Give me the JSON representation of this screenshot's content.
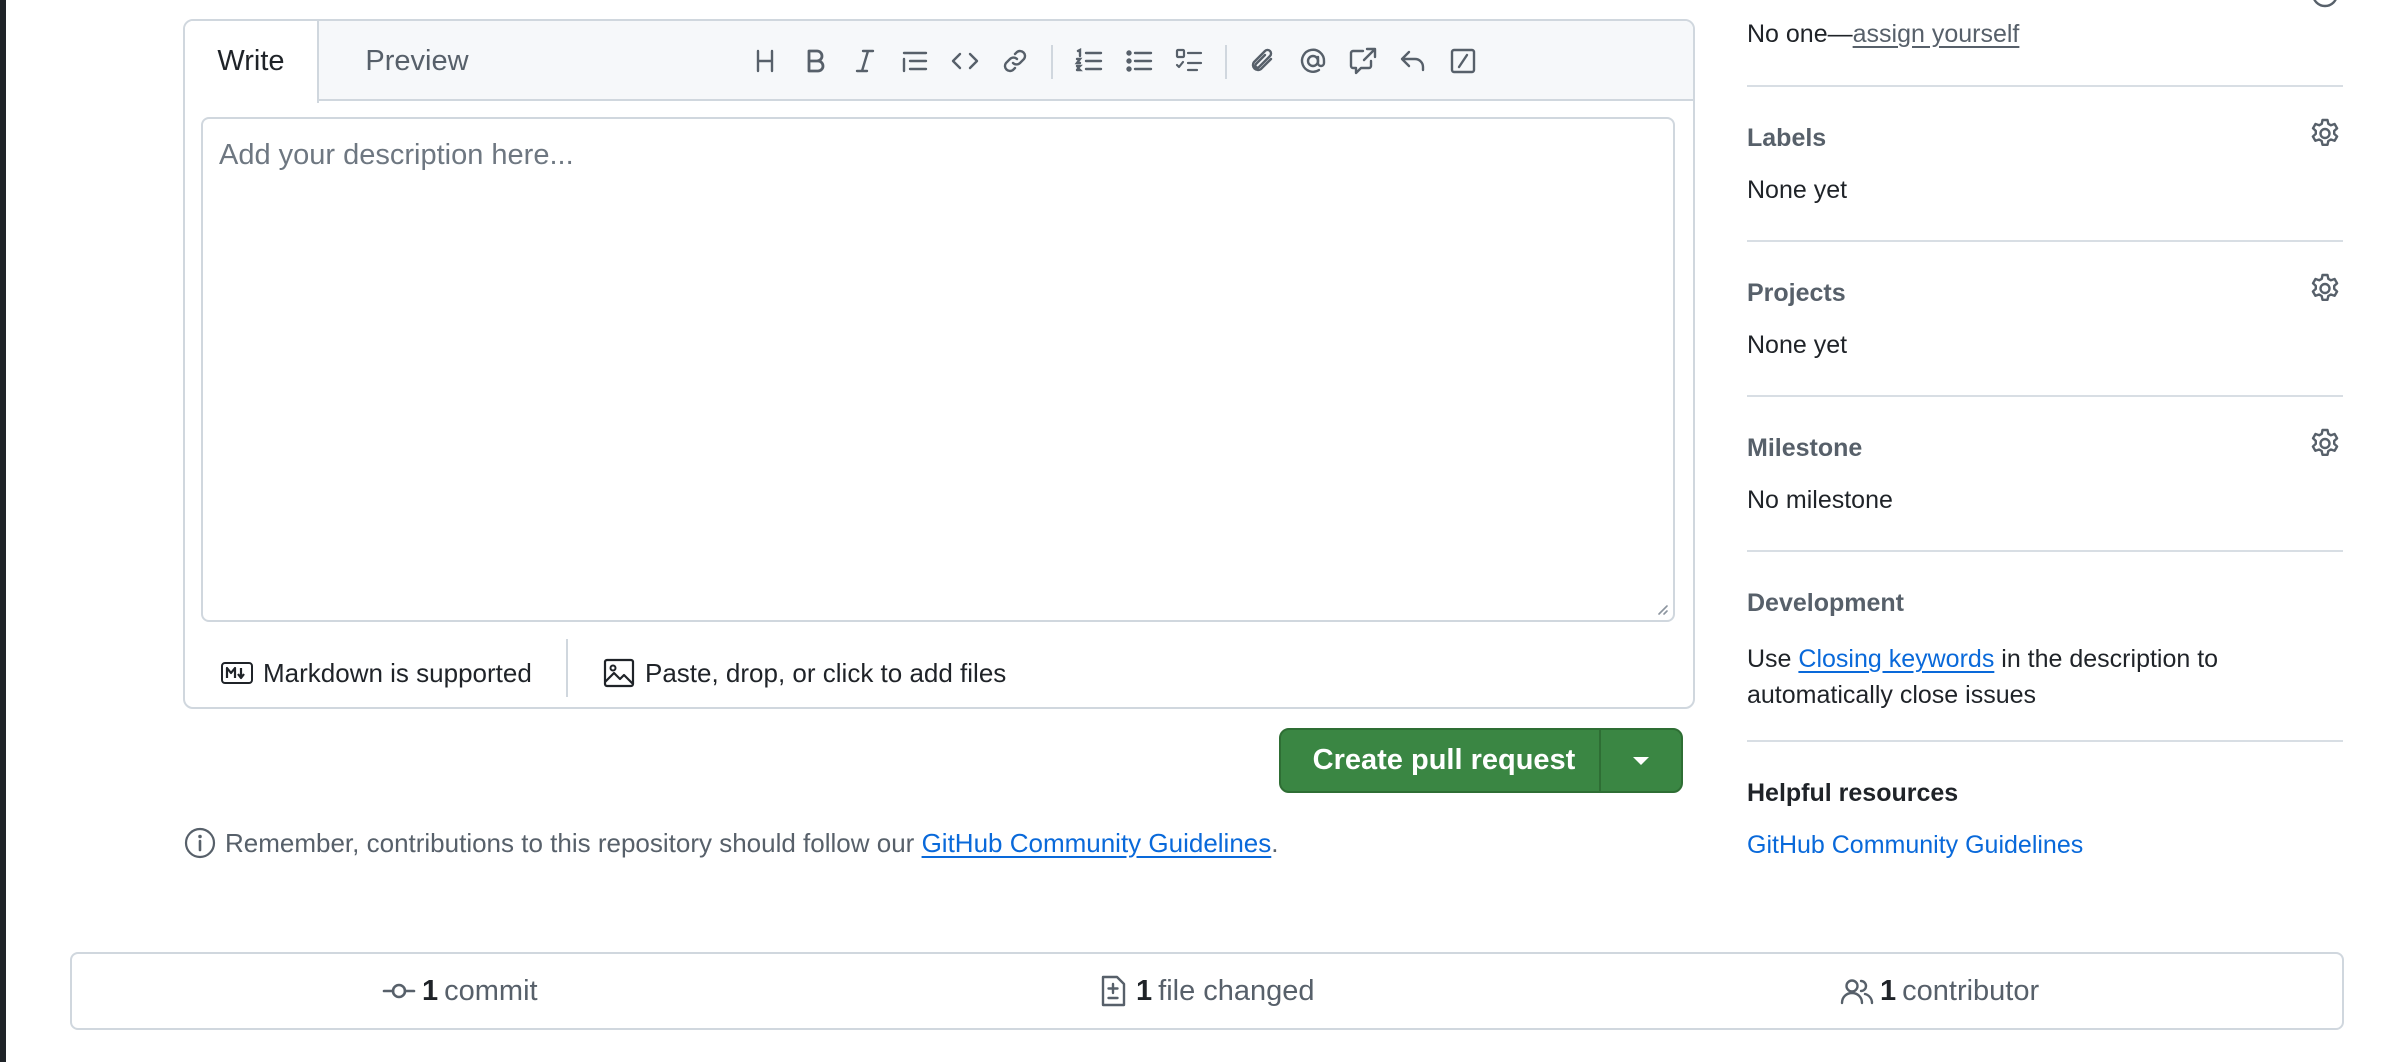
{
  "editor": {
    "tabs": {
      "write": "Write",
      "preview": "Preview"
    },
    "textarea_placeholder": "Add your description here...",
    "footer": {
      "markdown_label": "Markdown is supported",
      "attach_label": "Paste, drop, or click to add files"
    },
    "toolbar_icons": [
      "heading-icon",
      "bold-icon",
      "italic-icon",
      "quote-icon",
      "code-icon",
      "link-icon",
      "ordered-list-icon",
      "unordered-list-icon",
      "task-list-icon",
      "attach-icon",
      "mention-icon",
      "cross-reference-icon",
      "reply-icon",
      "slash-command-icon"
    ]
  },
  "create_pr": {
    "label": "Create pull request"
  },
  "note": {
    "prefix": "Remember, contributions to this repository should follow our ",
    "link": "GitHub Community Guidelines",
    "suffix": "."
  },
  "sidebar": {
    "assignees": {
      "prefix": "No one—",
      "link": "assign yourself"
    },
    "labels": {
      "heading": "Labels",
      "value": "None yet"
    },
    "projects": {
      "heading": "Projects",
      "value": "None yet"
    },
    "milestone": {
      "heading": "Milestone",
      "value": "No milestone"
    },
    "development": {
      "heading": "Development",
      "prefix": "Use ",
      "link": "Closing keywords",
      "suffix_line1": " in the description to",
      "line2": "automatically close issues"
    },
    "helpful": {
      "heading": "Helpful resources",
      "link": "GitHub Community Guidelines"
    }
  },
  "stats": {
    "commits": {
      "count": "1",
      "label": "commit"
    },
    "files": {
      "count": "1",
      "label": "file changed"
    },
    "contributors": {
      "count": "1",
      "label": "contributor"
    }
  },
  "colors": {
    "primary_button": "#3a8643",
    "link": "#0969da",
    "border": "#d0d7de",
    "muted_text": "#57606a"
  }
}
